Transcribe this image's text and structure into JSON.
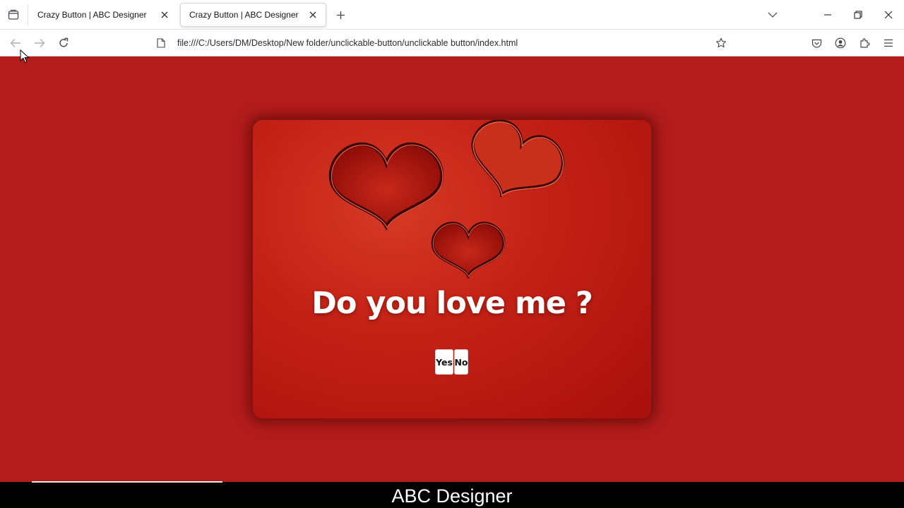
{
  "browser": {
    "tabs": [
      {
        "title": "Crazy Button | ABC Designer",
        "active": false
      },
      {
        "title": "Crazy Button | ABC Designer",
        "active": true
      }
    ],
    "url": "file:///C:/Users/DM/Desktop/New folder/unclickable-button/unclickable button/index.html",
    "icons": {
      "tab_list": "tab-list-icon",
      "tab_close": "close-icon",
      "new_tab": "plus-icon",
      "list_all_tabs": "chevron-down-icon",
      "minimize": "minimize-icon",
      "restore": "restore-icon",
      "close_window": "close-icon",
      "back": "back-arrow-icon",
      "forward": "forward-arrow-icon",
      "reload": "reload-icon",
      "page": "page-icon",
      "bookmark": "star-icon",
      "pocket": "pocket-icon",
      "account": "account-icon",
      "extensions": "extensions-icon",
      "menu": "hamburger-menu-icon"
    }
  },
  "page": {
    "background": "#b41c1c",
    "question": "Do you love me ?",
    "buttons": {
      "yes": "Yes",
      "no": "No"
    }
  },
  "caption": "ABC Designer"
}
